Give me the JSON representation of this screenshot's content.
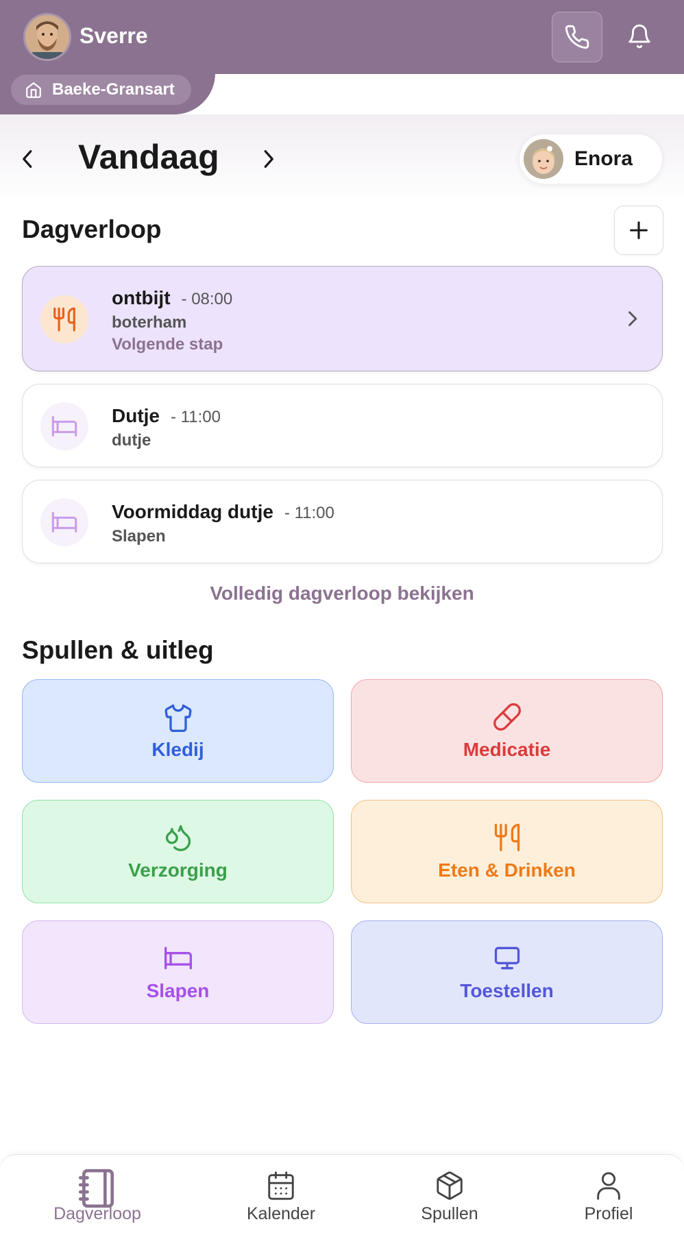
{
  "header": {
    "user_name": "Sverre",
    "household": "Baeke-Gransart",
    "icons": {
      "phone": "phone-icon",
      "bell": "bell-icon",
      "home": "home-icon"
    }
  },
  "day_nav": {
    "title": "Vandaag",
    "child_name": "Enora"
  },
  "timeline": {
    "section_title": "Dagverloop",
    "items": [
      {
        "title": "ontbijt",
        "time": "- 08:00",
        "subtitle": "boterham",
        "status": "Volgende stap",
        "icon": "fork-knife-icon"
      },
      {
        "title": "Dutje",
        "time": "- 11:00",
        "subtitle": "dutje",
        "icon": "bed-icon"
      },
      {
        "title": "Voormiddag dutje",
        "time": "- 11:00",
        "subtitle": "Slapen",
        "icon": "bed-icon"
      }
    ],
    "view_all": "Volledig dagverloop bekijken"
  },
  "things": {
    "section_title": "Spullen & uitleg",
    "tiles": [
      {
        "label": "Kledij",
        "icon": "shirt-icon",
        "color": "#2f5fdb",
        "bg": "#dce8fd",
        "border": "#93b6f5"
      },
      {
        "label": "Medicatie",
        "icon": "pill-icon",
        "color": "#dc3b3b",
        "bg": "#fbe2e2",
        "border": "#f0a6a6"
      },
      {
        "label": "Verzorging",
        "icon": "droplets-icon",
        "color": "#3aa04a",
        "bg": "#def8e6",
        "border": "#8ee3a6"
      },
      {
        "label": "Eten & Drinken",
        "icon": "fork-knife-icon",
        "color": "#ef7a17",
        "bg": "#feefdb",
        "border": "#f6c085"
      },
      {
        "label": "Slapen",
        "icon": "bed-icon",
        "color": "#a650e8",
        "bg": "#f1e6fb",
        "border": "#d6b6f3"
      },
      {
        "label": "Toestellen",
        "icon": "monitor-icon",
        "color": "#5457d8",
        "bg": "#e1e6fb",
        "border": "#a4b0f1"
      }
    ]
  },
  "bottom_nav": {
    "items": [
      {
        "label": "Dagverloop",
        "icon": "notebook-icon",
        "active": true
      },
      {
        "label": "Kalender",
        "icon": "calendar-icon"
      },
      {
        "label": "Spullen",
        "icon": "package-icon"
      },
      {
        "label": "Profiel",
        "icon": "user-icon"
      }
    ]
  },
  "colors": {
    "brand": "#8b7290",
    "active_card_bg": "#ede3fc",
    "meal_icon": "#e8611a",
    "sleep_icon": "#c99bea"
  }
}
